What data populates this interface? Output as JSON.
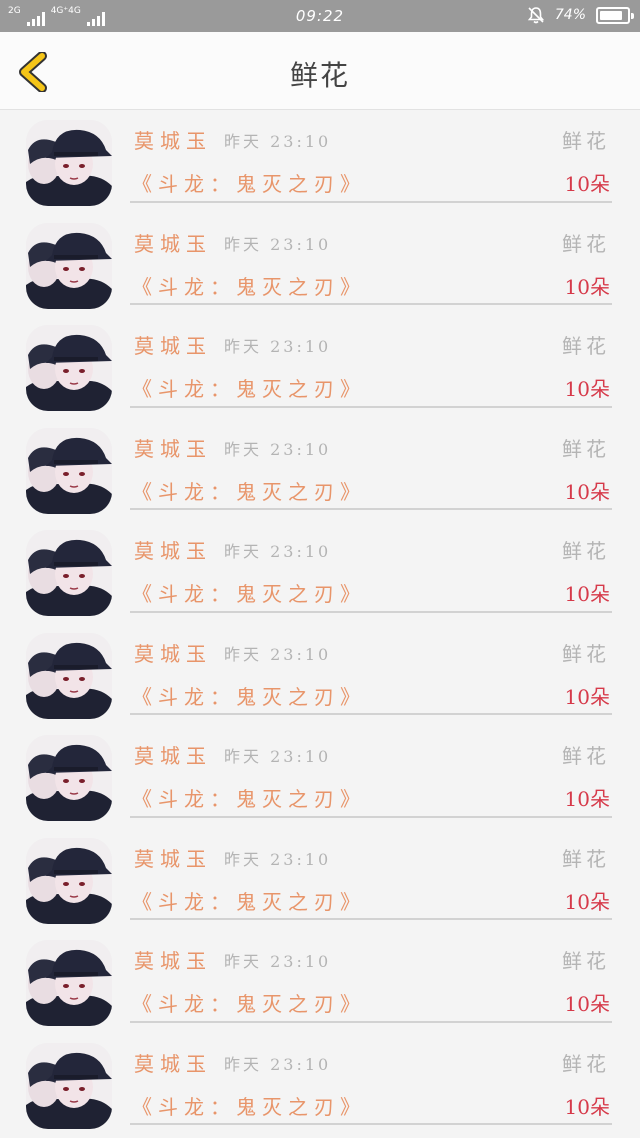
{
  "status_bar": {
    "network_1": "2G",
    "network_2": "4G⁺4G",
    "time": "09:22",
    "battery": "74%",
    "battery_level": 0.74,
    "icons": [
      "signal-icon",
      "bell-mute-icon",
      "battery-icon"
    ]
  },
  "header": {
    "title": "鲜花",
    "back_icon": "chevron-left-icon",
    "accent_color": "#f5c518"
  },
  "colors": {
    "name": "#e8956a",
    "amount": "#d63a4a",
    "muted": "#b4b4b4"
  },
  "list": {
    "items": [
      {
        "name": "莫城玉",
        "time": "昨天 23:10",
        "gift": "鲜花",
        "book": "《斗龙：鬼灭之刃》",
        "amount": "10朵"
      },
      {
        "name": "莫城玉",
        "time": "昨天 23:10",
        "gift": "鲜花",
        "book": "《斗龙：鬼灭之刃》",
        "amount": "10朵"
      },
      {
        "name": "莫城玉",
        "time": "昨天 23:10",
        "gift": "鲜花",
        "book": "《斗龙：鬼灭之刃》",
        "amount": "10朵"
      },
      {
        "name": "莫城玉",
        "time": "昨天 23:10",
        "gift": "鲜花",
        "book": "《斗龙：鬼灭之刃》",
        "amount": "10朵"
      },
      {
        "name": "莫城玉",
        "time": "昨天 23:10",
        "gift": "鲜花",
        "book": "《斗龙：鬼灭之刃》",
        "amount": "10朵"
      },
      {
        "name": "莫城玉",
        "time": "昨天 23:10",
        "gift": "鲜花",
        "book": "《斗龙：鬼灭之刃》",
        "amount": "10朵"
      },
      {
        "name": "莫城玉",
        "time": "昨天 23:10",
        "gift": "鲜花",
        "book": "《斗龙：鬼灭之刃》",
        "amount": "10朵"
      },
      {
        "name": "莫城玉",
        "time": "昨天 23:10",
        "gift": "鲜花",
        "book": "《斗龙：鬼灭之刃》",
        "amount": "10朵"
      },
      {
        "name": "莫城玉",
        "time": "昨天 23:10",
        "gift": "鲜花",
        "book": "《斗龙：鬼灭之刃》",
        "amount": "10朵"
      },
      {
        "name": "莫城玉",
        "time": "昨天 23:10",
        "gift": "鲜花",
        "book": "《斗龙：鬼灭之刃》",
        "amount": "10朵"
      }
    ]
  }
}
